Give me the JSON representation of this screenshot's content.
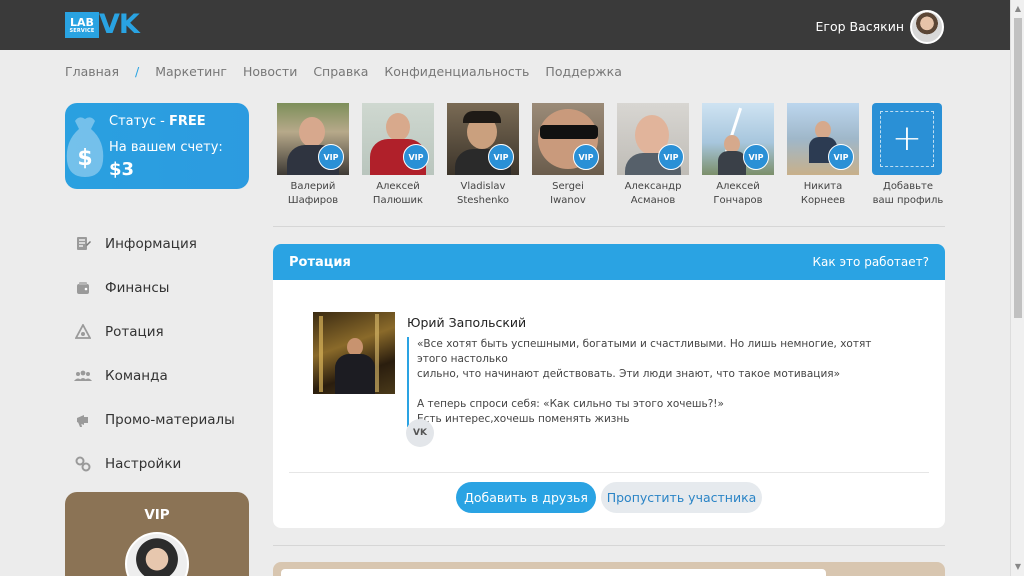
{
  "header": {
    "logo_lab": "LAB",
    "logo_service": "SERVICE",
    "logo_vk": "VK",
    "user_name": "Егор Васякин"
  },
  "topnav": {
    "items": [
      "Главная",
      "/",
      "Маркетинг",
      "Новости",
      "Справка",
      "Конфиденциальность",
      "Поддержка"
    ]
  },
  "status": {
    "label": "Статус - ",
    "value": "FREE",
    "balance_label": "На вашем счету:",
    "balance_value": "$3",
    "bag_symbol": "$"
  },
  "sidebar": {
    "items": [
      {
        "label": "Информация",
        "icon": "info-icon"
      },
      {
        "label": "Финансы",
        "icon": "wallet-icon"
      },
      {
        "label": "Ротация",
        "icon": "rotation-icon"
      },
      {
        "label": "Команда",
        "icon": "team-icon"
      },
      {
        "label": "Промо-материалы",
        "icon": "megaphone-icon"
      },
      {
        "label": "Настройки",
        "icon": "settings-icon"
      }
    ]
  },
  "vip_card": {
    "title": "VIP"
  },
  "vip_strip": {
    "badge": "VIP",
    "members": [
      {
        "name_line1": "Валерий",
        "name_line2": "Шафиров"
      },
      {
        "name_line1": "Алексей",
        "name_line2": "Палюшик"
      },
      {
        "name_line1": "Vladislav",
        "name_line2": "Steshenko"
      },
      {
        "name_line1": "Sergei",
        "name_line2": "Iwanov"
      },
      {
        "name_line1": "Александр",
        "name_line2": "Асманов"
      },
      {
        "name_line1": "Алексей",
        "name_line2": "Гончаров"
      },
      {
        "name_line1": "Никита",
        "name_line2": "Корнеев"
      }
    ],
    "add": {
      "plus": "+",
      "line1": "Добавьте",
      "line2": "ваш профиль"
    }
  },
  "rotation": {
    "title": "Ротация",
    "help_link": "Как это работает?",
    "person_name": "Юрий Запольский",
    "quote_line1": "«Все хотят быть успешными, богатыми и счастливыми. Но лишь немногие, хотят этого настолько",
    "quote_line2": "сильно, что начинают действовать. Эти люди знают, что такое мотивация»",
    "quote_line3": "А теперь спроси себя: «Как сильно ты этого хочешь?!»",
    "quote_line4": "Есть интерес,хочешь поменять жизнь",
    "vk_label": "VK",
    "add_friend": "Добавить в друзья",
    "skip": "Пропустить участника"
  },
  "colors": {
    "accent": "#2aa3e3",
    "header_bg": "#3a3a3a",
    "vip_bg": "#8b7355"
  }
}
